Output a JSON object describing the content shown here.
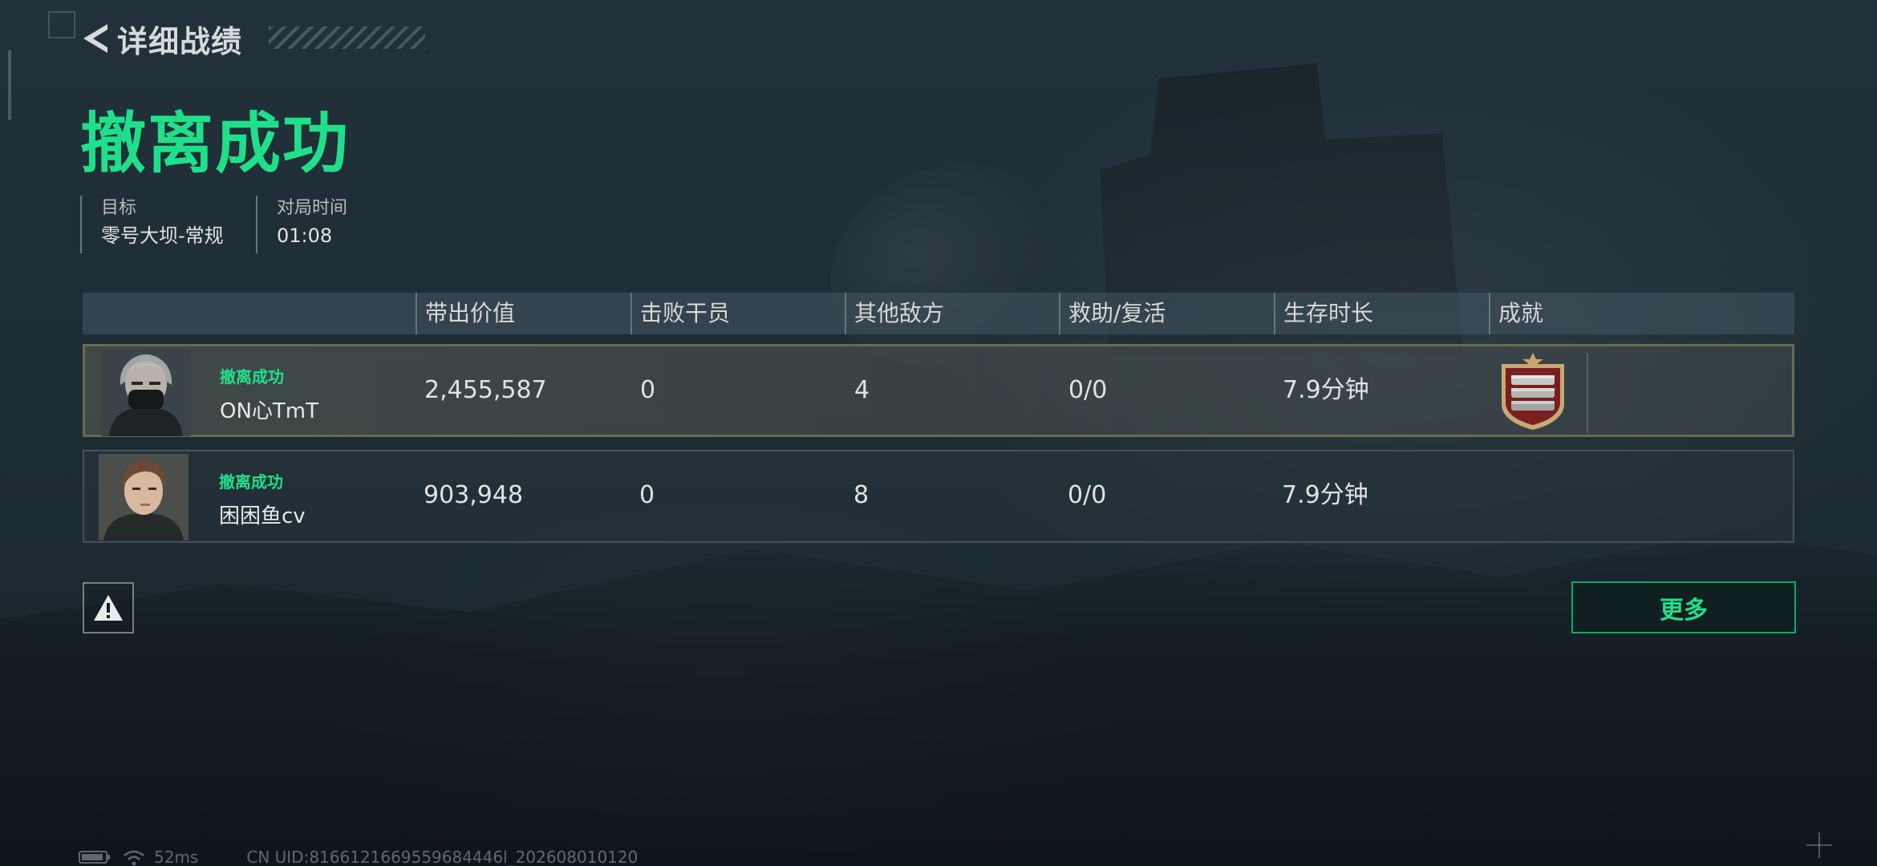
{
  "header": {
    "back_title": "详细战绩"
  },
  "result": {
    "title": "撤离成功",
    "title_color": "#1fe08a"
  },
  "info": {
    "target_label": "目标",
    "target_value": "零号大坝-常规",
    "time_label": "对局时间",
    "time_value": "01:08"
  },
  "table": {
    "columns": [
      "带出价值",
      "击败干员",
      "其他敌方",
      "救助/复活",
      "生存时长",
      "成就"
    ],
    "rows": [
      {
        "status": "撤离成功",
        "name": "ON心TmT",
        "value": "2,455,587",
        "kills": "0",
        "other_enemies": "4",
        "assist": "0/0",
        "survival": "7.9分钟",
        "achievement_icon": "medal-icon",
        "highlighted": true
      },
      {
        "status": "撤离成功",
        "name": "困困鱼cv",
        "value": "903,948",
        "kills": "0",
        "other_enemies": "8",
        "assist": "0/0",
        "survival": "7.9分钟",
        "achievement_icon": "",
        "highlighted": false
      }
    ]
  },
  "actions": {
    "report_icon": "warning-icon",
    "more_label": "更多",
    "accent_color": "#15a56a"
  },
  "status_bar": {
    "latency": "52ms",
    "uid": "CN UID:8166121669559684446l_202608010120"
  }
}
